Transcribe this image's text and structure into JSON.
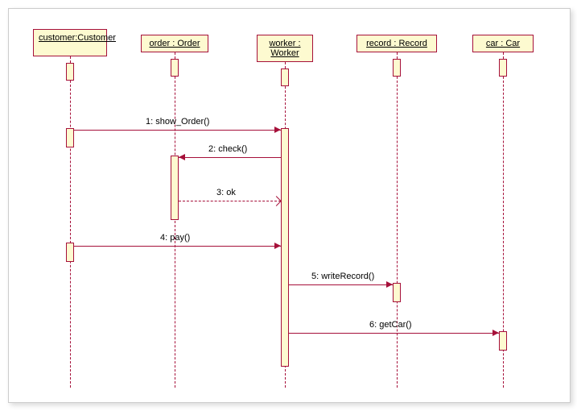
{
  "lifelines": {
    "customer": {
      "label": "customer:Customer"
    },
    "order": {
      "label": "order : Order"
    },
    "worker": {
      "label": "worker : Worker"
    },
    "record": {
      "label": "record : Record"
    },
    "car": {
      "label": "car : Car"
    }
  },
  "messages": {
    "m1": {
      "label": "1: show_Order()"
    },
    "m2": {
      "label": "2: check()"
    },
    "m3": {
      "label": "3: ok"
    },
    "m4": {
      "label": "4: pay()"
    },
    "m5": {
      "label": "5: writeRecord()"
    },
    "m6": {
      "label": "6: getCar()"
    }
  },
  "chart_data": {
    "type": "uml-sequence-diagram",
    "lifelines": [
      {
        "id": "customer",
        "label": "customer:Customer"
      },
      {
        "id": "order",
        "label": "order : Order"
      },
      {
        "id": "worker",
        "label": "worker : Worker"
      },
      {
        "id": "record",
        "label": "record : Record"
      },
      {
        "id": "car",
        "label": "car : Car"
      }
    ],
    "messages": [
      {
        "seq": 1,
        "from": "customer",
        "to": "worker",
        "label": "show_Order()",
        "type": "sync"
      },
      {
        "seq": 2,
        "from": "worker",
        "to": "order",
        "label": "check()",
        "type": "sync"
      },
      {
        "seq": 3,
        "from": "order",
        "to": "worker",
        "label": "ok",
        "type": "return"
      },
      {
        "seq": 4,
        "from": "customer",
        "to": "worker",
        "label": "pay()",
        "type": "sync"
      },
      {
        "seq": 5,
        "from": "worker",
        "to": "record",
        "label": "writeRecord()",
        "type": "sync"
      },
      {
        "seq": 6,
        "from": "worker",
        "to": "car",
        "label": "getCar()",
        "type": "sync"
      }
    ]
  }
}
